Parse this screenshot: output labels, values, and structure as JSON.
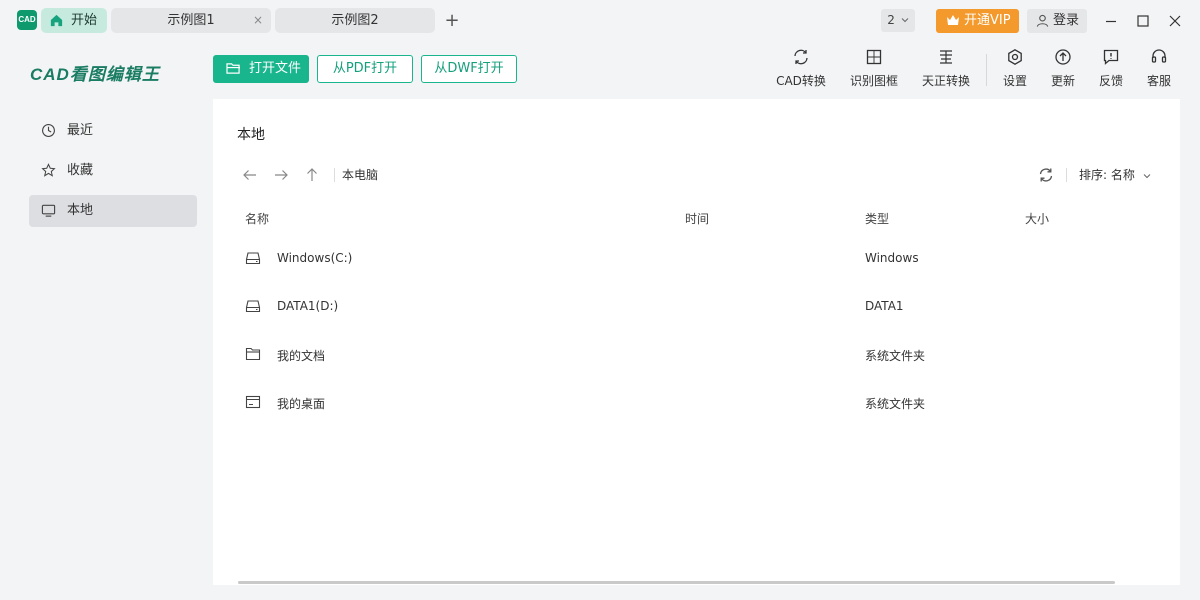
{
  "app": {
    "logo_text": "CAD",
    "brand": "CAD看图编辑王"
  },
  "tabs": [
    {
      "label": "开始",
      "icon": "home-icon",
      "active": true
    },
    {
      "label": "示例图1",
      "close": "×"
    },
    {
      "label": "示例图2"
    }
  ],
  "titlebar": {
    "add_tab": "+",
    "window_count": "2",
    "vip_label": "开通VIP",
    "login_label": "登录"
  },
  "toolbar": {
    "open_file": "打开文件",
    "open_pdf": "从PDF打开",
    "open_dwf": "从DWF打开",
    "tools": [
      {
        "label": "CAD转换",
        "icon": "convert-icon"
      },
      {
        "label": "识别图框",
        "icon": "frame-icon"
      },
      {
        "label": "天正转换",
        "icon": "tangent-convert-icon"
      },
      {
        "label": "设置",
        "icon": "gear-icon"
      },
      {
        "label": "更新",
        "icon": "update-icon"
      },
      {
        "label": "反馈",
        "icon": "feedback-icon"
      },
      {
        "label": "客服",
        "icon": "headset-icon"
      }
    ]
  },
  "sidebar": {
    "items": [
      {
        "label": "最近",
        "icon": "clock-icon"
      },
      {
        "label": "收藏",
        "icon": "star-icon"
      },
      {
        "label": "本地",
        "icon": "monitor-icon",
        "active": true
      }
    ]
  },
  "main": {
    "title": "本地",
    "path": "本电脑",
    "sort_label": "排序:",
    "sort_value": "名称",
    "columns": [
      "名称",
      "时间",
      "类型",
      "大小"
    ],
    "rows": [
      {
        "name": "Windows(C:)",
        "type": "Windows",
        "icon": "drive-icon"
      },
      {
        "name": "DATA1(D:)",
        "type": "DATA1",
        "icon": "drive-icon"
      },
      {
        "name": "我的文档",
        "type": "系统文件夹",
        "icon": "folder-icon"
      },
      {
        "name": "我的桌面",
        "type": "系统文件夹",
        "icon": "desktop-icon"
      }
    ]
  },
  "colors": {
    "accent": "#19b58d",
    "brand": "#1a7c63",
    "vip": "#f4992c"
  }
}
